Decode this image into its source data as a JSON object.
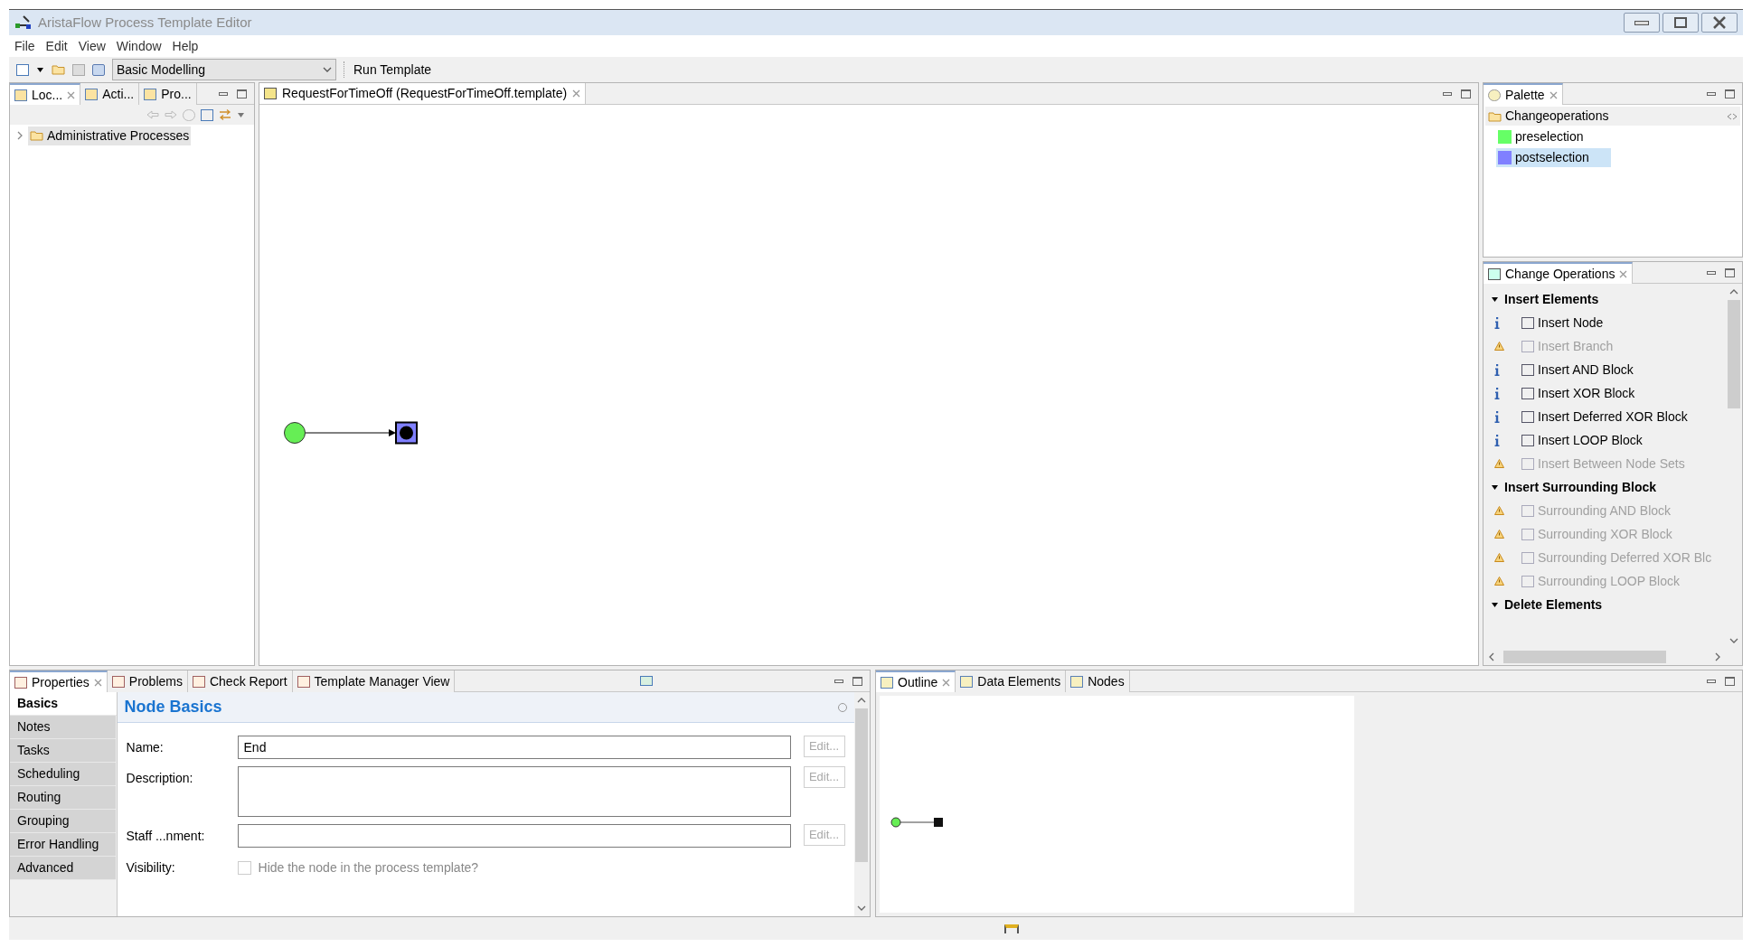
{
  "window": {
    "title": "AristaFlow Process Template Editor"
  },
  "menu": [
    "File",
    "Edit",
    "View",
    "Window",
    "Help"
  ],
  "toolbar": {
    "perspective": "Basic Modelling",
    "run_button": "Run Template"
  },
  "navigator": {
    "tabs": [
      {
        "label": "Loc...",
        "selected": true
      },
      {
        "label": "Acti...",
        "selected": false
      },
      {
        "label": "Pro...",
        "selected": false
      }
    ],
    "tree": [
      {
        "label": "Administrative Processes",
        "expanded": false,
        "selected": true
      }
    ]
  },
  "editor": {
    "tab": "RequestForTimeOff (RequestForTimeOff.template)"
  },
  "palette": {
    "tab": "Palette",
    "group": "Changeoperations",
    "items": [
      {
        "label": "preselection",
        "color": "#66ff66",
        "selected": false
      },
      {
        "label": "postselection",
        "color": "#8080ff",
        "selected": true
      }
    ]
  },
  "change_operations": {
    "tab": "Change Operations",
    "sections": [
      {
        "title": "Insert Elements",
        "expanded": true,
        "items": [
          {
            "label": "Insert Node",
            "kind": "info",
            "disabled": false
          },
          {
            "label": "Insert Branch",
            "kind": "warning",
            "disabled": true
          },
          {
            "label": "Insert AND Block",
            "kind": "info",
            "disabled": false
          },
          {
            "label": "Insert XOR Block",
            "kind": "info",
            "disabled": false
          },
          {
            "label": "Insert Deferred XOR Block",
            "kind": "info",
            "disabled": false
          },
          {
            "label": "Insert LOOP Block",
            "kind": "info",
            "disabled": false
          },
          {
            "label": "Insert Between Node Sets",
            "kind": "warning",
            "disabled": true
          }
        ]
      },
      {
        "title": "Insert Surrounding Block",
        "expanded": true,
        "items": [
          {
            "label": "Surrounding AND Block",
            "kind": "warning",
            "disabled": true
          },
          {
            "label": "Surrounding XOR Block",
            "kind": "warning",
            "disabled": true
          },
          {
            "label": "Surrounding Deferred XOR Blc",
            "kind": "warning",
            "disabled": true
          },
          {
            "label": "Surrounding LOOP Block",
            "kind": "warning",
            "disabled": true
          }
        ]
      },
      {
        "title": "Delete Elements",
        "expanded": true
      }
    ]
  },
  "properties": {
    "tabs": [
      {
        "label": "Properties",
        "selected": true
      },
      {
        "label": "Problems",
        "selected": false
      },
      {
        "label": "Check Report",
        "selected": false
      },
      {
        "label": "Template Manager View",
        "selected": false
      }
    ],
    "side_tabs": [
      {
        "label": "Basics",
        "selected": true
      },
      {
        "label": "Notes",
        "selected": false
      },
      {
        "label": "Tasks",
        "selected": false
      },
      {
        "label": "Scheduling",
        "selected": false
      },
      {
        "label": "Routing",
        "selected": false
      },
      {
        "label": "Grouping",
        "selected": false
      },
      {
        "label": "Error Handling",
        "selected": false
      },
      {
        "label": "Advanced",
        "selected": false
      }
    ],
    "section_title": "Node Basics",
    "fields": [
      {
        "label": "Name:",
        "kind": "text",
        "value": "End",
        "button": "Edit...",
        "disabled": true
      },
      {
        "label": "Description:",
        "kind": "multiline",
        "button": "Edit...",
        "disabled": true
      },
      {
        "label": "Staff ...nment:",
        "kind": "text",
        "button": "Edit...",
        "disabled": true
      }
    ],
    "visibility": {
      "label": "Visibility:",
      "checkbox": "Hide the node in the process template?",
      "checked": false,
      "disabled": true
    }
  },
  "outline": {
    "tabs": [
      {
        "label": "Outline",
        "selected": true
      },
      {
        "label": "Data Elements",
        "selected": false
      },
      {
        "label": "Nodes",
        "selected": false
      }
    ]
  }
}
